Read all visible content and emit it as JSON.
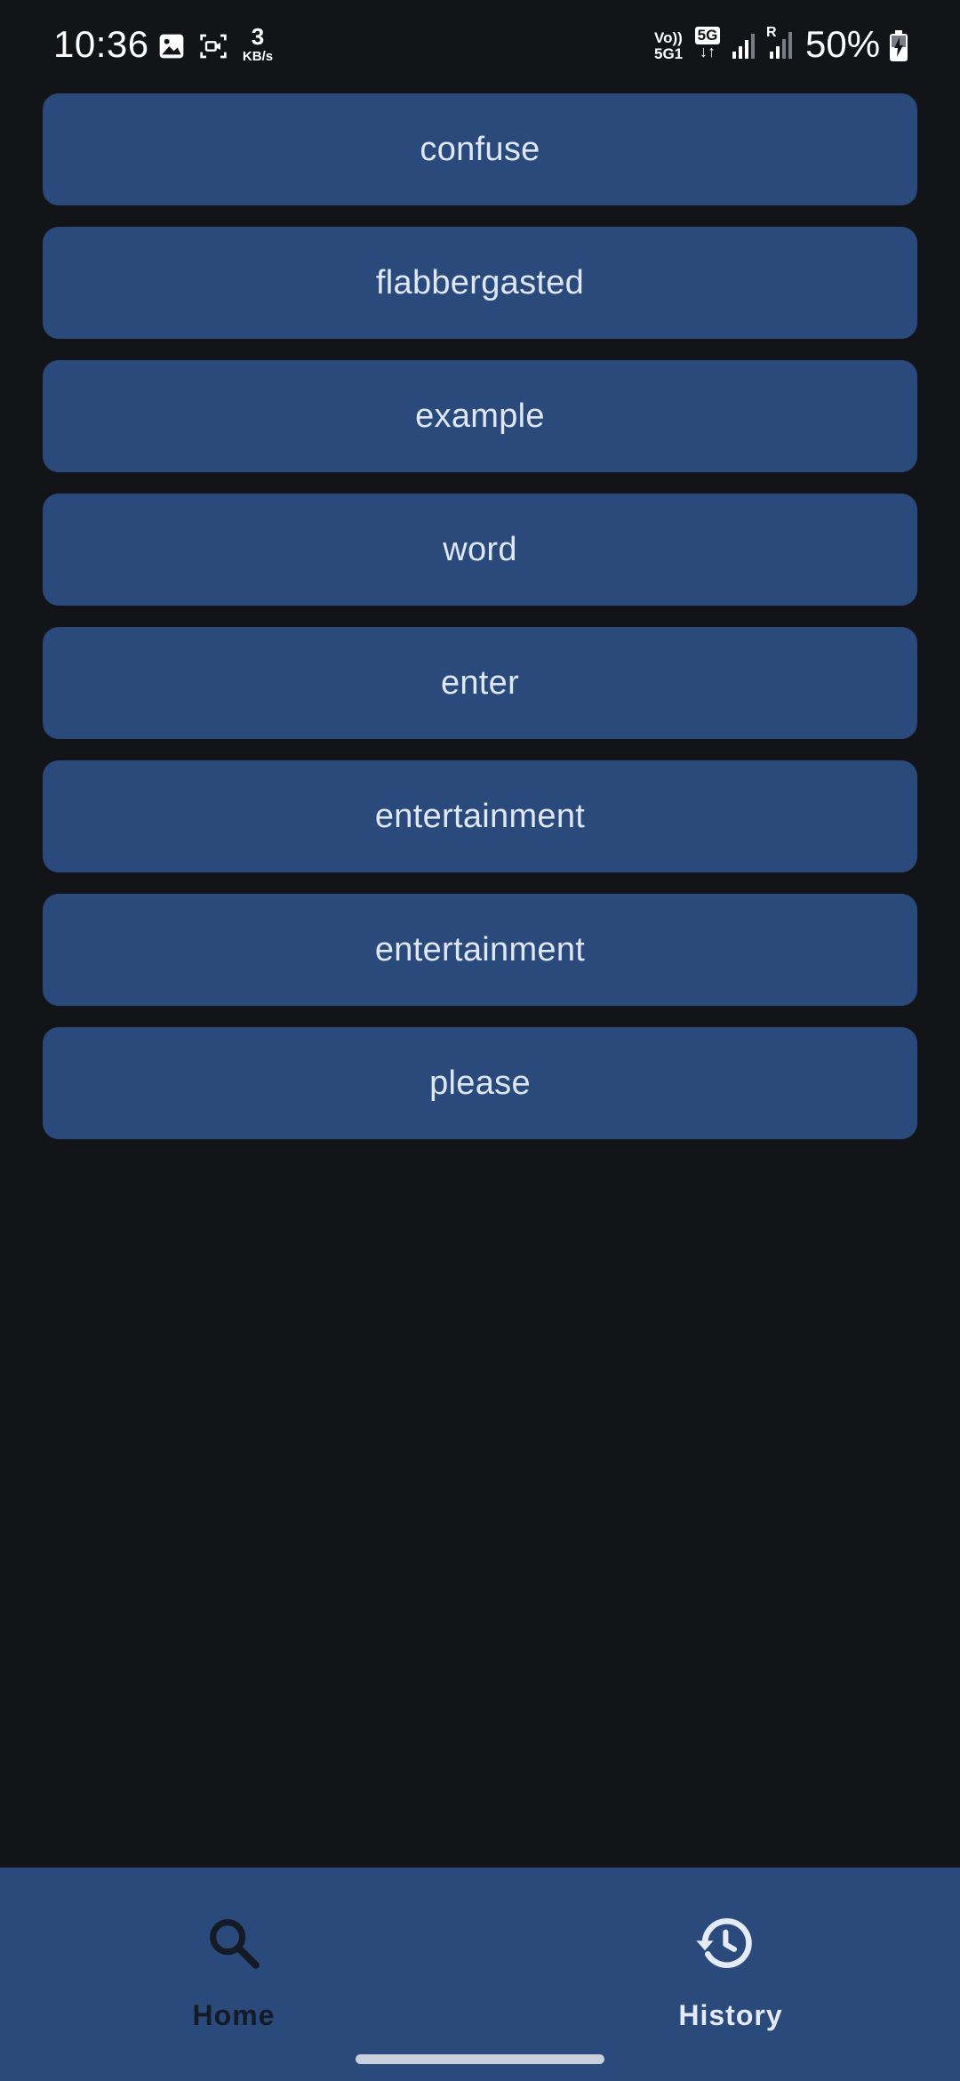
{
  "status_bar": {
    "time": "10:36",
    "net_speed_value": "3",
    "net_speed_unit": "KB/s",
    "volte_line1": "Vo))",
    "volte_line2": "5G1",
    "network_badge": "5G",
    "network_arrows": "↓↑",
    "roaming": "R",
    "battery_percent": "50%",
    "icons": [
      "gallery-icon",
      "screen-record-icon",
      "signal-icon",
      "signal-roaming-icon",
      "battery-charging-icon"
    ]
  },
  "history": {
    "items": [
      "confuse",
      "flabbergasted",
      "example",
      "word",
      "enter",
      "entertainment",
      "entertainment",
      "please"
    ]
  },
  "bottom_nav": {
    "items": [
      {
        "label": "Home",
        "icon": "search-icon",
        "active": false
      },
      {
        "label": "History",
        "icon": "history-icon",
        "active": true
      }
    ]
  },
  "colors": {
    "background": "#131418",
    "item_background": "#2b4a7c",
    "item_text": "#dfe6f4",
    "nav_background": "#2b4a7c",
    "nav_active": "#e4eaf6",
    "nav_inactive": "#141a26"
  }
}
